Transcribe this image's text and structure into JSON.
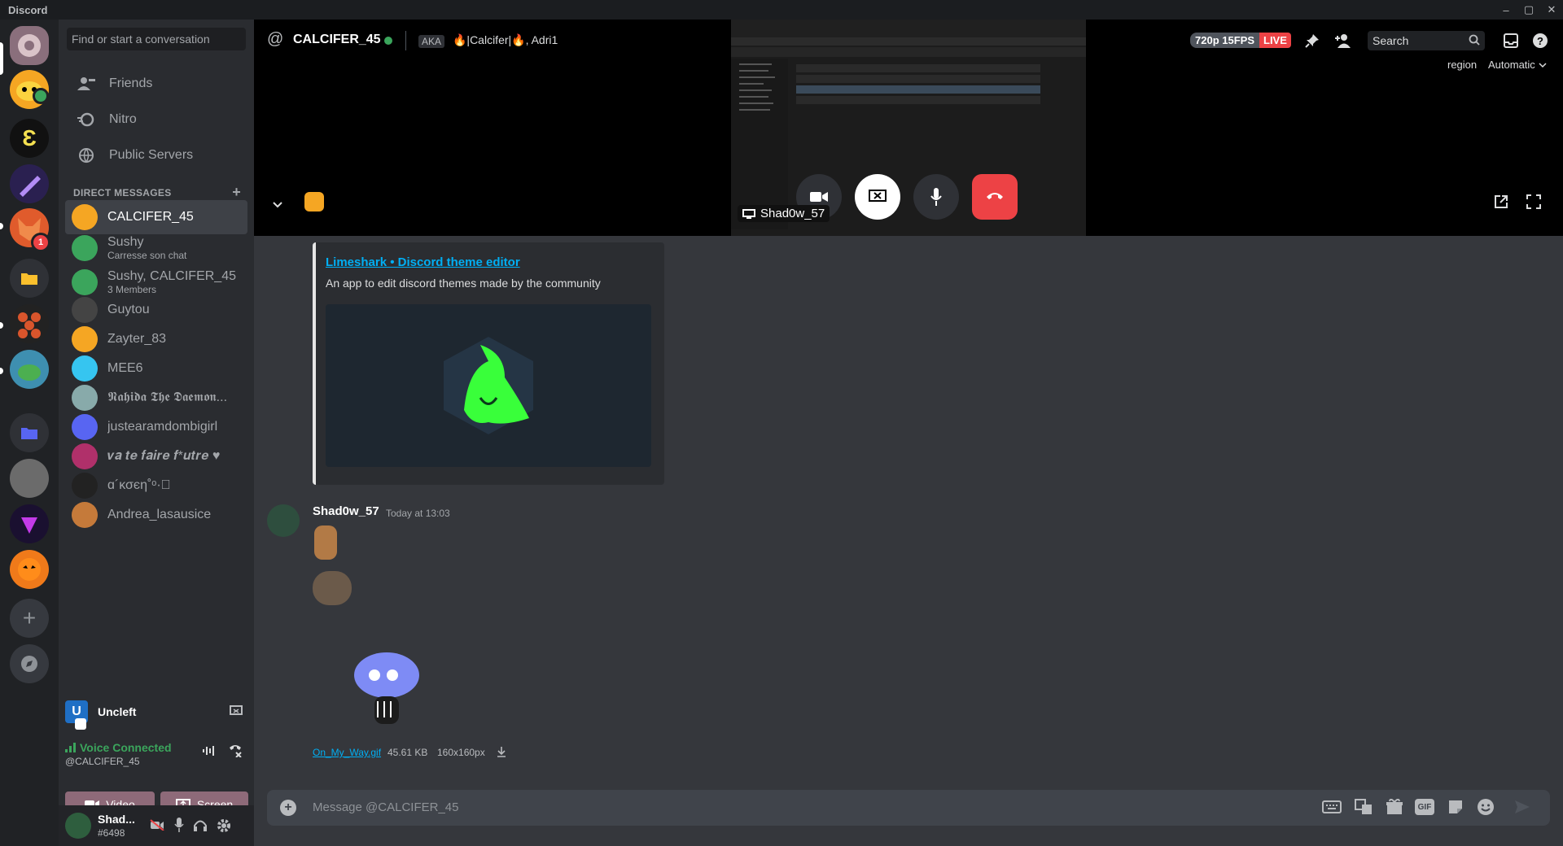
{
  "titlebar": {
    "app_name": "Discord",
    "min": "–",
    "max": "▢",
    "close": "✕"
  },
  "sidebar": {
    "search_placeholder": "Find or start a conversation",
    "nav": [
      {
        "label": "Friends",
        "icon": "friends-icon"
      },
      {
        "label": "Nitro",
        "icon": "nitro-icon"
      },
      {
        "label": "Public Servers",
        "icon": "globe-icon"
      }
    ],
    "dm_header": "DIRECT MESSAGES",
    "dm_add": "+",
    "dms": [
      {
        "name": "CALCIFER_45",
        "sub": "",
        "color": "#f5a623",
        "active": true
      },
      {
        "name": "Sushy",
        "sub": "Carresse son chat",
        "color": "#3ba55c"
      },
      {
        "name": "Sushy, CALCIFER_45",
        "sub": "3 Members",
        "color": "#3ba55c"
      },
      {
        "name": "Guytou",
        "sub": "",
        "color": "#444"
      },
      {
        "name": "Zayter_83",
        "sub": "",
        "color": "#f5a623"
      },
      {
        "name": "MEE6",
        "sub": "",
        "color": "#36c5f0"
      },
      {
        "name": "𝕹𝖆𝖍𝖎𝖉𝖆 𝕿𝖍𝖊 𝕯𝖆𝖊𝖒𝖔𝖓...",
        "sub": "",
        "color": "#8aa"
      },
      {
        "name": "justearamdombigirl",
        "sub": "",
        "color": "#5865f2"
      },
      {
        "name": "𝒗𝒂 𝒕𝒆 𝒇𝒂𝒊𝒓𝒆 𝒇*𝒖𝒕𝒓𝒆 ♥",
        "sub": "",
        "color": "#b0306a"
      },
      {
        "name": "ɑ´κσєη˚ᵒ·⃝",
        "sub": "",
        "color": "#222"
      },
      {
        "name": "Andrea_lasausice",
        "sub": "",
        "color": "#c57a3a"
      }
    ]
  },
  "user_card": {
    "initial": "U",
    "name": "Uncleft"
  },
  "voice": {
    "status": "Voice Connected",
    "channel": "@CALCIFER_45",
    "video_label": "Video",
    "screen_label": "Screen"
  },
  "profile": {
    "name": "Shad...",
    "tag": "#6498"
  },
  "header": {
    "at": "@",
    "username": "CALCIFER_45",
    "aka": "AKA",
    "aka_names": "🔥|Calcifer|🔥, Adri1",
    "quality": "720p 15FPS",
    "live": "LIVE",
    "search_placeholder": "Search",
    "region_label": "region",
    "region_value": "Automatic"
  },
  "stream": {
    "name": "Shad0w_57"
  },
  "embed": {
    "title": "Limeshark • Discord theme editor",
    "description": "An app to edit discord themes made by the community"
  },
  "message": {
    "author": "Shad0w_57",
    "timestamp": "Today at 13:03",
    "file_name": "On_My_Way.gif",
    "file_size": "45.61 KB",
    "file_dims": "160x160px"
  },
  "input": {
    "placeholder": "Message @CALCIFER_45"
  },
  "colors": {
    "accent": "#5865f2",
    "green": "#3ba55c",
    "red": "#ed4245",
    "live": "#ed4245"
  }
}
